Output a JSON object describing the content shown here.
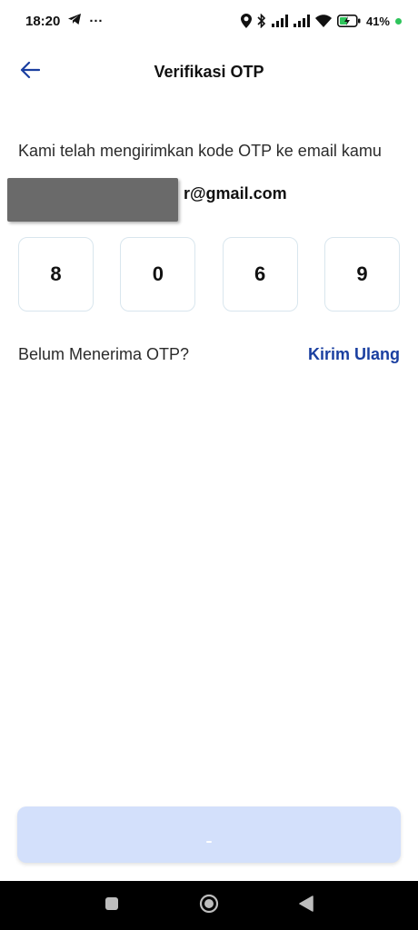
{
  "status_bar": {
    "time": "18:20",
    "more": "···",
    "battery_percent": "41%"
  },
  "header": {
    "title": "Verifikasi OTP"
  },
  "content": {
    "description": "Kami telah mengirimkan kode OTP ke email kamu",
    "email_visible": "r@gmail.com",
    "otp_digits": [
      "8",
      "0",
      "6",
      "9"
    ],
    "resend_question": "Belum Menerima OTP?",
    "resend_link": "Kirim Ulang"
  },
  "colors": {
    "accent": "#1a3fa0",
    "button_bg": "#d3e0fb",
    "otp_border": "#d9e6ee"
  },
  "icons": {
    "back": "arrow-left-icon",
    "location": "location-icon",
    "bluetooth": "bluetooth-icon",
    "signal": "signal-icon",
    "wifi": "wifi-icon",
    "battery": "battery-charging-icon",
    "telegram": "telegram-icon",
    "nav_recent": "square-icon",
    "nav_home": "circle-icon",
    "nav_back": "triangle-back-icon"
  }
}
